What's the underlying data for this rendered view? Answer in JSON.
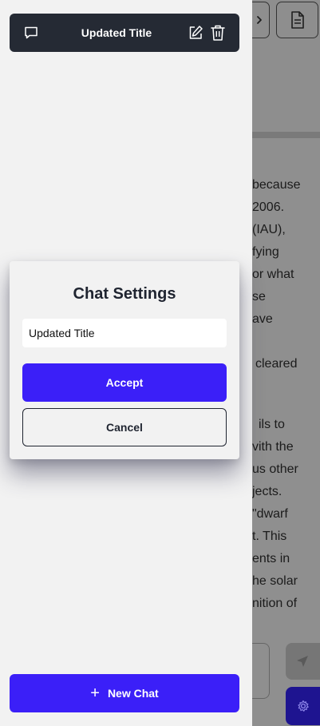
{
  "sidebar": {
    "chat_item": {
      "title": "Updated Title",
      "icon": "chat-bubble-icon",
      "edit_icon": "edit-icon",
      "delete_icon": "trash-icon"
    },
    "new_chat": {
      "label": "New Chat",
      "icon": "plus-icon"
    }
  },
  "modal": {
    "title": "Chat Settings",
    "input_value": "Updated Title",
    "accept_label": "Accept",
    "cancel_label": "Cancel"
  },
  "main": {
    "top_buttons": [
      "chevron-right-icon",
      "document-icon"
    ],
    "message_lines": [
      " because",
      "2006.",
      "(IAU),",
      "fying",
      "or what",
      "se",
      "ave",
      "",
      "cleared",
      "",
      "ils to",
      "vith the",
      "us other",
      "jects.",
      "\"dwarf",
      "t. This",
      "ents in",
      "he solar",
      "nition of"
    ],
    "send_icon": "send-icon",
    "settings_icon": "gear-icon"
  },
  "colors": {
    "accent": "#3b1ff8",
    "chat_item_bg": "#252a34",
    "sidebar_bg": "#f2f2f2",
    "overlay_bg": "#8f8f8f"
  }
}
